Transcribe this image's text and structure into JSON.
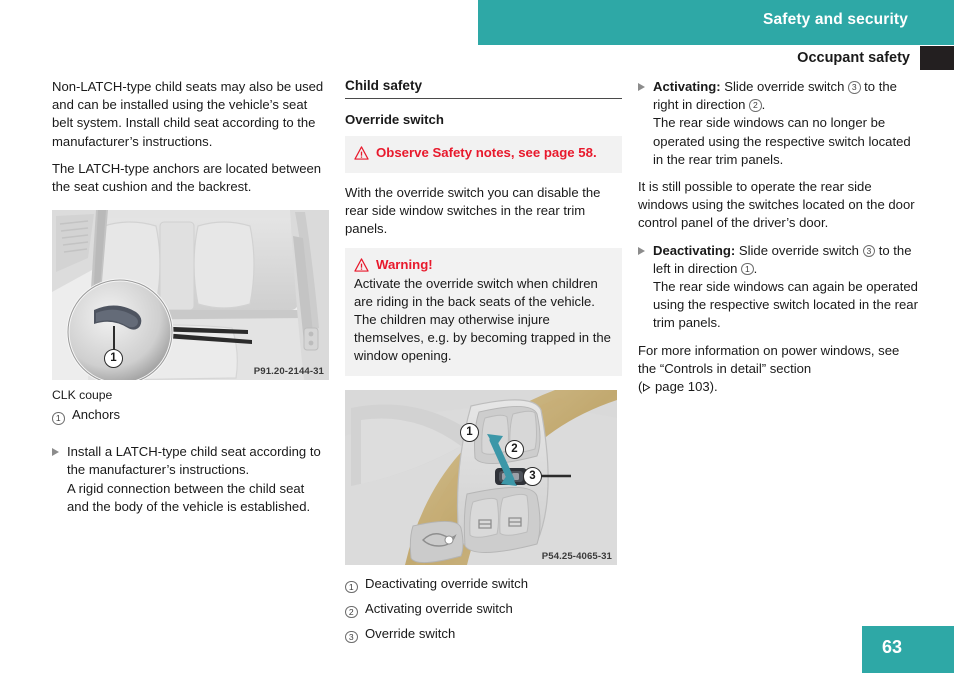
{
  "header": {
    "banner_title": "Safety and security",
    "section_title": "Occupant safety"
  },
  "footer": {
    "page_number": "63"
  },
  "columns": {
    "left": {
      "paragraph_1": "Non-LATCH-type child seats may also be used and can be installed using the vehicle’s seat belt system. Install child seat according to the manufacturer’s instructions.",
      "paragraph_2": "The LATCH-type anchors are located between the seat cushion and the backrest.",
      "figure": {
        "code": "P91.20-2144-31",
        "callout_1": "1",
        "alt": "Rear seats of CLK coupe with magnified detail of LATCH anchor"
      },
      "caption_model": "CLK coupe",
      "legend": [
        {
          "num": "1",
          "label": "Anchors"
        }
      ],
      "bullet_1": {
        "text": "Install a LATCH-type child seat according to the manufacturer’s instructions.",
        "followup": "A rigid connection between the child seat and the body of the vehicle is established."
      }
    },
    "middle": {
      "heading_major": "Child safety",
      "heading_minor": "Override switch",
      "note_box": {
        "icon": "warning-triangle-icon",
        "title": "Observe Safety notes, see page 58."
      },
      "paragraph_1": "With the override switch you can disable the rear side window switches in the rear trim panels.",
      "warning_box": {
        "icon": "warning-triangle-icon",
        "title": "Warning!",
        "body": "Activate the override switch when children are riding in the back seats of the vehicle. The children may otherwise injure themselves, e.g. by becoming trapped in the window opening."
      },
      "figure": {
        "code": "P54.25-4065-31",
        "callout_1": "1",
        "callout_2": "2",
        "callout_3": "3",
        "alt": "Driver door control panel with power window switches and override switch"
      },
      "legend": [
        {
          "num": "1",
          "label": "Deactivating override switch"
        },
        {
          "num": "2",
          "label": "Activating override switch"
        },
        {
          "num": "3",
          "label": "Override switch"
        }
      ]
    },
    "right": {
      "bullet_activating": {
        "lead": "Activating:",
        "text_a": " Slide override switch ",
        "ref_1": "3",
        "text_b": " to the right in direction ",
        "ref_2": "2",
        "text_c": ".",
        "followup": "The rear side windows can no longer be operated using the respective switch located in the rear trim panels."
      },
      "paragraph_1": "It is still possible to operate the rear side windows using the switches located on the door control panel of the driver’s door.",
      "bullet_deactivating": {
        "lead": "Deactivating:",
        "text_a": " Slide override switch ",
        "ref_1": "3",
        "text_b": " to the left in direction ",
        "ref_2": "1",
        "text_c": ".",
        "followup": "The rear side windows can again be operated using the respective switch located in the rear trim panels."
      },
      "paragraph_2_a": "For more information on power windows, see the “Controls in detail” section",
      "paragraph_2_b": "page 103)."
    }
  },
  "colors": {
    "accent_teal": "#2ea8a6",
    "warning_red": "#e8192c",
    "note_bg": "#f2f2f2",
    "tab_black": "#231f20"
  }
}
